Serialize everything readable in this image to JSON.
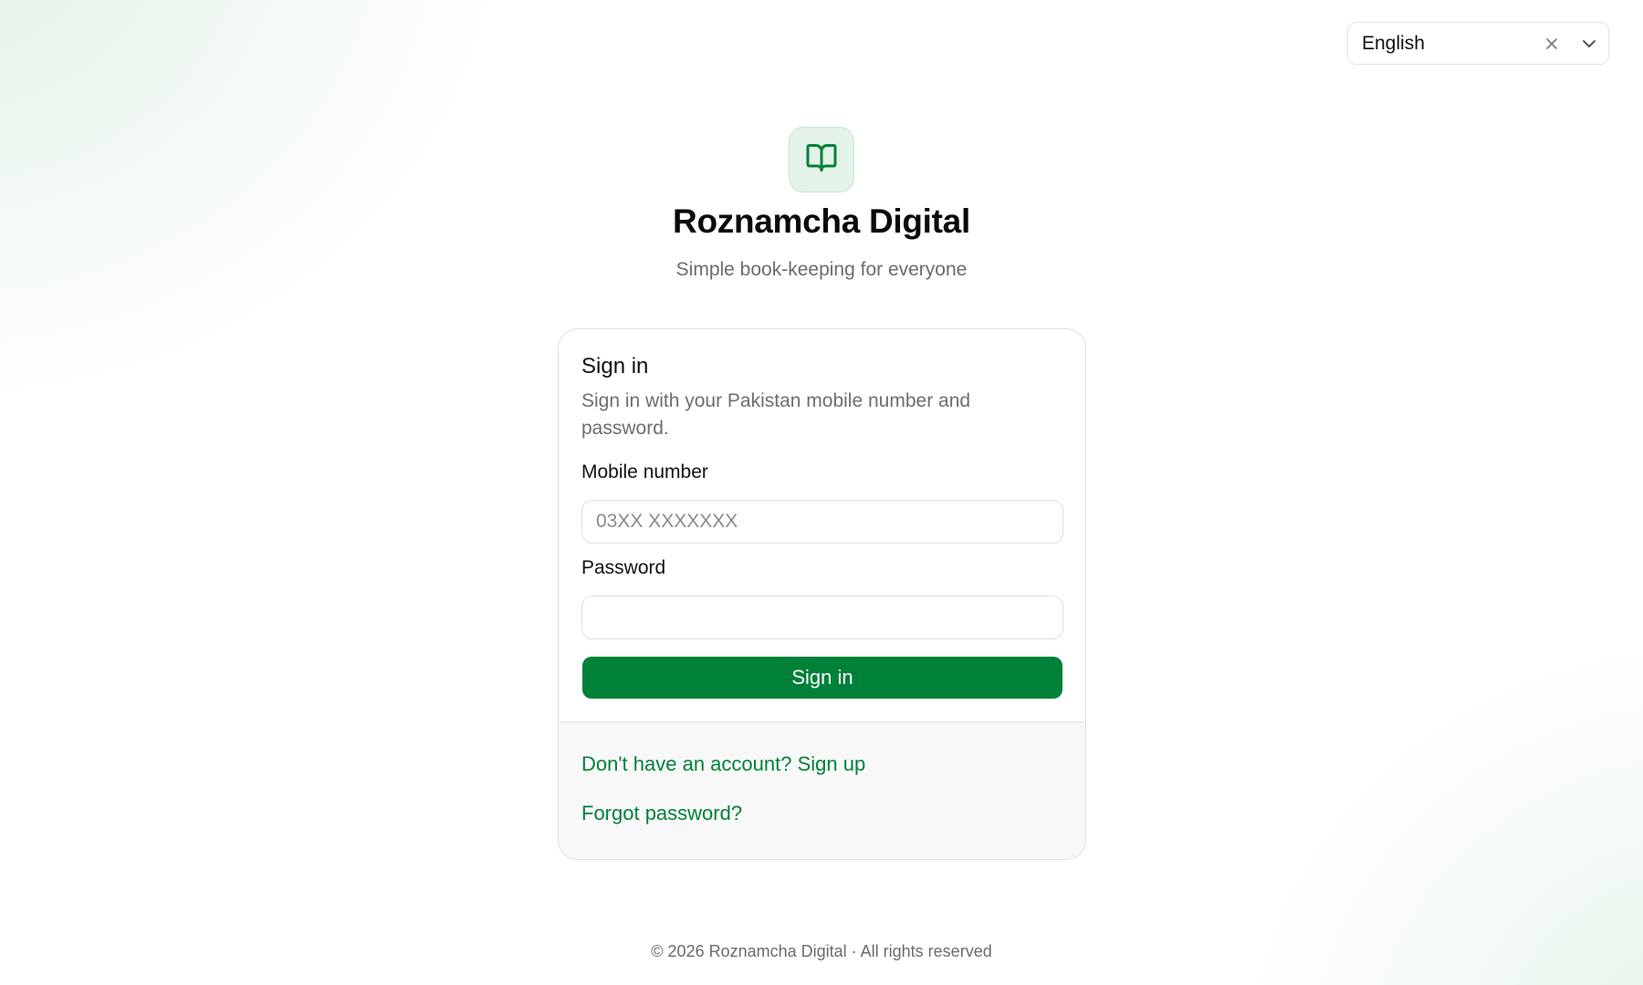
{
  "language_select": {
    "value": "English"
  },
  "brand": {
    "logo_icon": "open-book-icon",
    "title": "Roznamcha Digital",
    "subtitle": "Simple book-keeping for everyone",
    "accent_color": "#00813a"
  },
  "signin_card": {
    "title": "Sign in",
    "description": "Sign in with your Pakistan mobile number and password.",
    "mobile": {
      "label": "Mobile number",
      "placeholder": "03XX XXXXXXX",
      "value": ""
    },
    "password": {
      "label": "Password",
      "value": ""
    },
    "submit_label": "Sign in",
    "signup_link": "Don't have an account? Sign up",
    "forgot_link": "Forgot password?"
  },
  "footer": {
    "copyright": "© 2026 Roznamcha Digital · All rights reserved"
  }
}
